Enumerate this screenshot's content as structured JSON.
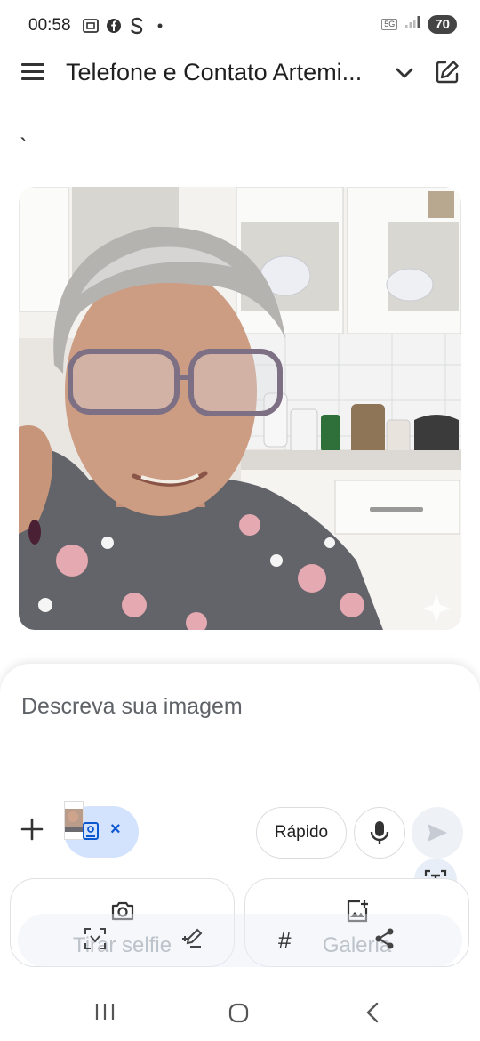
{
  "status_bar": {
    "time": "00:58",
    "icons": [
      "screenshot-icon",
      "facebook-icon",
      "s-app-icon",
      "dot-icon"
    ],
    "network": "5G",
    "battery": "70"
  },
  "header": {
    "title": "Telefone e Contato Artemi...",
    "menu_icon": "hamburger-icon",
    "dropdown_icon": "chevron-down-icon",
    "edit_icon": "edit-icon"
  },
  "message": {
    "text": "`"
  },
  "input": {
    "placeholder": "Descreva sua imagem"
  },
  "attachment": {
    "remove": "×"
  },
  "controls": {
    "mode_label": "Rápido"
  },
  "cards": {
    "camera_label": "Tirar selfie",
    "gallery_label": "Galeria"
  },
  "overlay": {
    "hash": "#"
  },
  "colors": {
    "accent": "#0b57d0",
    "chip_bg": "#d3e3fd"
  }
}
